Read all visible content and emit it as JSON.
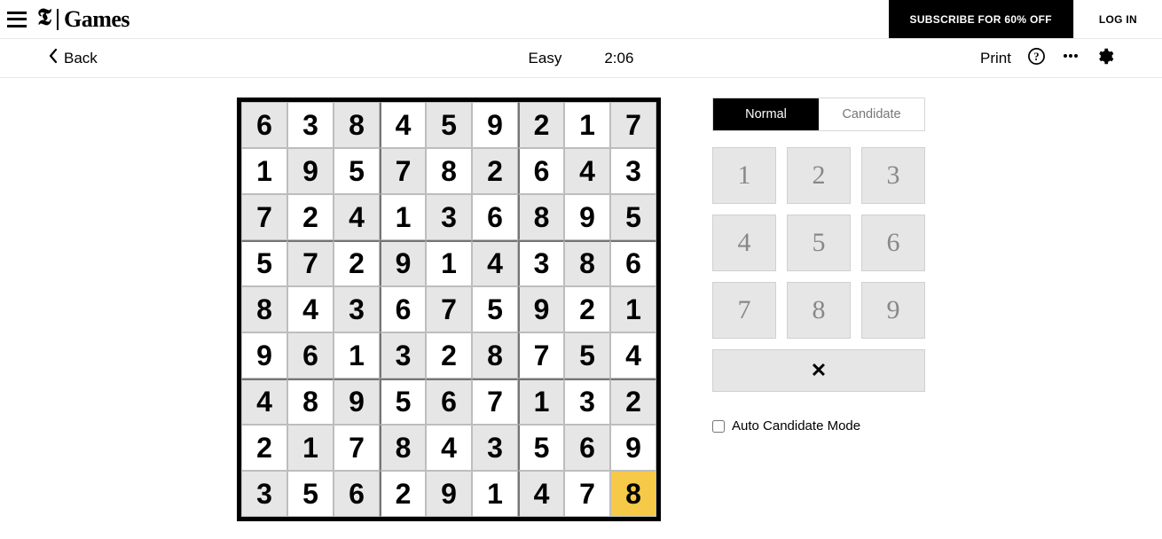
{
  "header": {
    "logo_games": "Games",
    "subscribe_label": "SUBSCRIBE FOR 60% OFF",
    "login_label": "LOG IN"
  },
  "toolbar": {
    "back_label": "Back",
    "difficulty": "Easy",
    "timer": "2:06",
    "print_label": "Print"
  },
  "modes": {
    "normal": "Normal",
    "candidate": "Candidate",
    "active": "normal"
  },
  "keypad": [
    "1",
    "2",
    "3",
    "4",
    "5",
    "6",
    "7",
    "8",
    "9"
  ],
  "clear_symbol": "✕",
  "auto_candidate_label": "Auto Candidate Mode",
  "sudoku": {
    "grid": [
      [
        6,
        3,
        8,
        4,
        5,
        9,
        2,
        1,
        7
      ],
      [
        1,
        9,
        5,
        7,
        8,
        2,
        6,
        4,
        3
      ],
      [
        7,
        2,
        4,
        1,
        3,
        6,
        8,
        9,
        5
      ],
      [
        5,
        7,
        2,
        9,
        1,
        4,
        3,
        8,
        6
      ],
      [
        8,
        4,
        3,
        6,
        7,
        5,
        9,
        2,
        1
      ],
      [
        9,
        6,
        1,
        3,
        2,
        8,
        7,
        5,
        4
      ],
      [
        4,
        8,
        9,
        5,
        6,
        7,
        1,
        3,
        2
      ],
      [
        2,
        1,
        7,
        8,
        4,
        3,
        5,
        6,
        9
      ],
      [
        3,
        5,
        6,
        2,
        9,
        1,
        4,
        7,
        8
      ]
    ],
    "shaded": [
      [
        0,
        0
      ],
      [
        0,
        2
      ],
      [
        0,
        4
      ],
      [
        0,
        6
      ],
      [
        0,
        8
      ],
      [
        1,
        1
      ],
      [
        1,
        3
      ],
      [
        1,
        5
      ],
      [
        1,
        7
      ],
      [
        2,
        0
      ],
      [
        2,
        2
      ],
      [
        2,
        4
      ],
      [
        2,
        6
      ],
      [
        2,
        8
      ],
      [
        3,
        1
      ],
      [
        3,
        3
      ],
      [
        3,
        5
      ],
      [
        3,
        7
      ],
      [
        4,
        0
      ],
      [
        4,
        2
      ],
      [
        4,
        4
      ],
      [
        4,
        6
      ],
      [
        4,
        8
      ],
      [
        5,
        1
      ],
      [
        5,
        3
      ],
      [
        5,
        5
      ],
      [
        5,
        7
      ],
      [
        6,
        0
      ],
      [
        6,
        2
      ],
      [
        6,
        4
      ],
      [
        6,
        6
      ],
      [
        6,
        8
      ],
      [
        7,
        1
      ],
      [
        7,
        3
      ],
      [
        7,
        5
      ],
      [
        7,
        7
      ],
      [
        8,
        0
      ],
      [
        8,
        2
      ],
      [
        8,
        4
      ],
      [
        8,
        6
      ]
    ],
    "selected": [
      8,
      8
    ]
  }
}
